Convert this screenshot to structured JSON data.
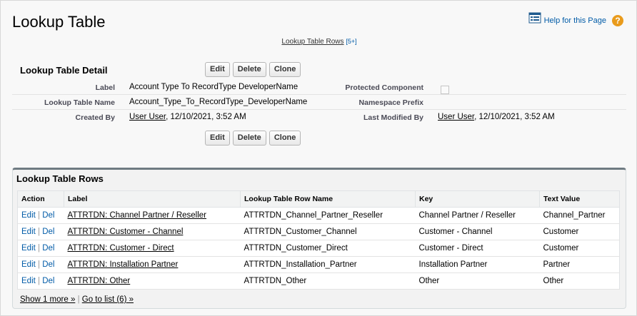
{
  "page": {
    "title": "Lookup Table",
    "help_link": "Help for this Page",
    "help_icon": "question-mark-icon",
    "related_list_link": "Lookup Table Rows",
    "related_list_count": "[5+]"
  },
  "detail": {
    "title": "Lookup Table Detail",
    "buttons": {
      "edit": "Edit",
      "delete": "Delete",
      "clone": "Clone"
    },
    "fields": {
      "label_label": "Label",
      "label_value": "Account Type To RecordType DeveloperName",
      "protected_label": "Protected Component",
      "name_label": "Lookup Table Name",
      "name_value": "Account_Type_To_RecordType_DeveloperName",
      "namespace_label": "Namespace Prefix",
      "namespace_value": "",
      "created_label": "Created By",
      "created_user": "User User",
      "created_date": ", 12/10/2021, 3:52 AM",
      "modified_label": "Last Modified By",
      "modified_user": "User User",
      "modified_date": ", 12/10/2021, 3:52 AM"
    }
  },
  "related_list": {
    "title": "Lookup Table Rows",
    "columns": [
      "Action",
      "Label",
      "Lookup Table Row Name",
      "Key",
      "Text Value"
    ],
    "action_edit": "Edit",
    "action_sep": "|",
    "action_del": "Del",
    "rows": [
      {
        "label": "ATTRTDN: Channel Partner / Reseller",
        "name": "ATTRTDN_Channel_Partner_Reseller",
        "key": "Channel Partner / Reseller",
        "value": "Channel_Partner"
      },
      {
        "label": "ATTRTDN: Customer - Channel",
        "name": "ATTRTDN_Customer_Channel",
        "key": "Customer - Channel",
        "value": "Customer"
      },
      {
        "label": "ATTRTDN: Customer - Direct",
        "name": "ATTRTDN_Customer_Direct",
        "key": "Customer - Direct",
        "value": "Customer"
      },
      {
        "label": "ATTRTDN: Installation Partner",
        "name": "ATTRTDN_Installation_Partner",
        "key": "Installation Partner",
        "value": "Partner"
      },
      {
        "label": "ATTRTDN: Other",
        "name": "ATTRTDN_Other",
        "key": "Other",
        "value": "Other"
      }
    ],
    "show_more": "Show 1 more »",
    "footer_sep": "|",
    "go_to_list": "Go to list (6) »"
  },
  "colors": {
    "link": "#015ba7",
    "help_icon": "#e99b1c",
    "related_list_border": "#6f7b82"
  }
}
